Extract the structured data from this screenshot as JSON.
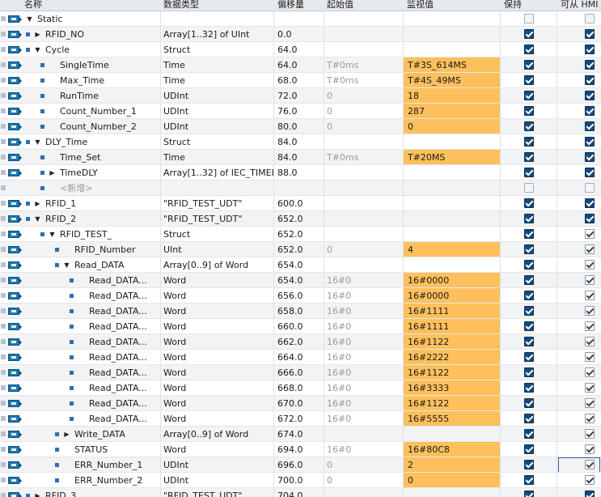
{
  "header": {
    "name": "名称",
    "datatype": "数据类型",
    "offset": "偏移量",
    "start_value": "起始值",
    "monitor_value": "监视值",
    "retain": "保持",
    "hmi": "可从 HMI"
  },
  "colors": {
    "highlight": "#fdc05c",
    "checkbox": "#17497c",
    "icon": "#1e78b4"
  },
  "rows": [
    {
      "level": 0,
      "expand": "down",
      "bullet": false,
      "icon": "interface-db-icon",
      "name": "Static",
      "type": "",
      "offset": "",
      "start": "",
      "monitor": "",
      "hl": false,
      "keep": "off",
      "hmi": "off"
    },
    {
      "level": 1,
      "expand": "right",
      "bullet": true,
      "icon": "interface-db-icon",
      "name": "RFID_NO",
      "type": "Array[1..32] of UInt",
      "offset": "0.0",
      "start": "",
      "monitor": "",
      "hl": false,
      "keep": "on",
      "hmi": "on"
    },
    {
      "level": 1,
      "expand": "down",
      "bullet": true,
      "icon": "interface-db-icon",
      "name": "Cycle",
      "type": "Struct",
      "offset": "64.0",
      "start": "",
      "monitor": "",
      "hl": false,
      "keep": "on",
      "hmi": "on"
    },
    {
      "level": 2,
      "expand": "",
      "bullet": true,
      "icon": "interface-db-icon",
      "name": "SingleTime",
      "type": "Time",
      "offset": "64.0",
      "start": "T#0ms",
      "monitor": "T#3S_614MS",
      "hl": true,
      "keep": "on",
      "hmi": "on"
    },
    {
      "level": 2,
      "expand": "",
      "bullet": true,
      "icon": "interface-db-icon",
      "name": "Max_Time",
      "type": "Time",
      "offset": "68.0",
      "start": "T#0ms",
      "monitor": "T#4S_49MS",
      "hl": true,
      "keep": "on",
      "hmi": "on"
    },
    {
      "level": 2,
      "expand": "",
      "bullet": true,
      "icon": "interface-db-icon",
      "name": "RunTime",
      "type": "UDInt",
      "offset": "72.0",
      "start": "0",
      "monitor": "18",
      "hl": true,
      "keep": "on",
      "hmi": "on"
    },
    {
      "level": 2,
      "expand": "",
      "bullet": true,
      "icon": "interface-db-icon",
      "name": "Count_Number_1",
      "type": "UDInt",
      "offset": "76.0",
      "start": "0",
      "monitor": "287",
      "hl": true,
      "keep": "on",
      "hmi": "on"
    },
    {
      "level": 2,
      "expand": "",
      "bullet": true,
      "icon": "interface-db-icon",
      "name": "Count_Number_2",
      "type": "UDInt",
      "offset": "80.0",
      "start": "0",
      "monitor": "0",
      "hl": true,
      "keep": "on",
      "hmi": "on"
    },
    {
      "level": 1,
      "expand": "down",
      "bullet": true,
      "icon": "interface-db-icon",
      "name": "DLY_Time",
      "type": "Struct",
      "offset": "84.0",
      "start": "",
      "monitor": "",
      "hl": false,
      "keep": "on",
      "hmi": "on"
    },
    {
      "level": 2,
      "expand": "",
      "bullet": true,
      "icon": "interface-db-icon",
      "name": "Time_Set",
      "type": "Time",
      "offset": "84.0",
      "start": "T#0ms",
      "monitor": "T#20MS",
      "hl": true,
      "keep": "on",
      "hmi": "on"
    },
    {
      "level": 2,
      "expand": "right",
      "bullet": true,
      "icon": "interface-db-icon",
      "name": "TimeDLY",
      "type": "Array[1..32] of IEC_TIMER",
      "offset": "88.0",
      "start": "",
      "monitor": "",
      "hl": false,
      "keep": "on",
      "hmi": "on"
    },
    {
      "level": 2,
      "expand": "",
      "bullet": true,
      "icon": "",
      "name": "<新增>",
      "type": "",
      "offset": "",
      "start": "",
      "monitor": "",
      "hl": false,
      "keep": "off",
      "hmi": "off",
      "isnew": true
    },
    {
      "level": 1,
      "expand": "right",
      "bullet": true,
      "icon": "interface-db-icon",
      "name": "RFID_1",
      "type": "\"RFID_TEST_UDT\"",
      "offset": "600.0",
      "start": "",
      "monitor": "",
      "hl": false,
      "keep": "on",
      "hmi": "on"
    },
    {
      "level": 1,
      "expand": "down",
      "bullet": true,
      "icon": "interface-db-icon",
      "name": "RFID_2",
      "type": "\"RFID_TEST_UDT\"",
      "offset": "652.0",
      "start": "",
      "monitor": "",
      "hl": false,
      "keep": "on",
      "hmi": "on"
    },
    {
      "level": 2,
      "expand": "down",
      "bullet": true,
      "icon": "interface-db-icon",
      "name": "RFID_TEST_",
      "type": "Struct",
      "offset": "652.0",
      "start": "",
      "monitor": "",
      "hl": false,
      "keep": "on",
      "hmi": "grey-on"
    },
    {
      "level": 3,
      "expand": "",
      "bullet": true,
      "icon": "interface-db-icon",
      "name": "RFID_Number",
      "type": "UInt",
      "offset": "652.0",
      "start": "0",
      "monitor": "4",
      "hl": true,
      "keep": "on",
      "hmi": "grey-on"
    },
    {
      "level": 3,
      "expand": "down",
      "bullet": true,
      "icon": "interface-db-icon",
      "name": "Read_DATA",
      "type": "Array[0..9] of Word",
      "offset": "654.0",
      "start": "",
      "monitor": "",
      "hl": false,
      "keep": "on",
      "hmi": "grey-on"
    },
    {
      "level": 4,
      "expand": "",
      "bullet": true,
      "icon": "interface-db-icon",
      "name": "Read_DATA...",
      "type": "Word",
      "offset": "654.0",
      "start": "16#0",
      "monitor": "16#0000",
      "hl": true,
      "keep": "on",
      "hmi": "grey-on"
    },
    {
      "level": 4,
      "expand": "",
      "bullet": true,
      "icon": "interface-db-icon",
      "name": "Read_DATA...",
      "type": "Word",
      "offset": "656.0",
      "start": "16#0",
      "monitor": "16#0000",
      "hl": true,
      "keep": "on",
      "hmi": "grey-on"
    },
    {
      "level": 4,
      "expand": "",
      "bullet": true,
      "icon": "interface-db-icon",
      "name": "Read_DATA...",
      "type": "Word",
      "offset": "658.0",
      "start": "16#0",
      "monitor": "16#1111",
      "hl": true,
      "keep": "on",
      "hmi": "grey-on"
    },
    {
      "level": 4,
      "expand": "",
      "bullet": true,
      "icon": "interface-db-icon",
      "name": "Read_DATA...",
      "type": "Word",
      "offset": "660.0",
      "start": "16#0",
      "monitor": "16#1111",
      "hl": true,
      "keep": "on",
      "hmi": "grey-on"
    },
    {
      "level": 4,
      "expand": "",
      "bullet": true,
      "icon": "interface-db-icon",
      "name": "Read_DATA...",
      "type": "Word",
      "offset": "662.0",
      "start": "16#0",
      "monitor": "16#1122",
      "hl": true,
      "keep": "on",
      "hmi": "grey-on"
    },
    {
      "level": 4,
      "expand": "",
      "bullet": true,
      "icon": "interface-db-icon",
      "name": "Read_DATA...",
      "type": "Word",
      "offset": "664.0",
      "start": "16#0",
      "monitor": "16#2222",
      "hl": true,
      "keep": "on",
      "hmi": "grey-on"
    },
    {
      "level": 4,
      "expand": "",
      "bullet": true,
      "icon": "interface-db-icon",
      "name": "Read_DATA...",
      "type": "Word",
      "offset": "666.0",
      "start": "16#0",
      "monitor": "16#1122",
      "hl": true,
      "keep": "on",
      "hmi": "grey-on"
    },
    {
      "level": 4,
      "expand": "",
      "bullet": true,
      "icon": "interface-db-icon",
      "name": "Read_DATA...",
      "type": "Word",
      "offset": "668.0",
      "start": "16#0",
      "monitor": "16#3333",
      "hl": true,
      "keep": "on",
      "hmi": "grey-on"
    },
    {
      "level": 4,
      "expand": "",
      "bullet": true,
      "icon": "interface-db-icon",
      "name": "Read_DATA...",
      "type": "Word",
      "offset": "670.0",
      "start": "16#0",
      "monitor": "16#1122",
      "hl": true,
      "keep": "on",
      "hmi": "grey-on"
    },
    {
      "level": 4,
      "expand": "",
      "bullet": true,
      "icon": "interface-db-icon",
      "name": "Read_DATA...",
      "type": "Word",
      "offset": "672.0",
      "start": "16#0",
      "monitor": "16#5555",
      "hl": true,
      "keep": "on",
      "hmi": "grey-on"
    },
    {
      "level": 3,
      "expand": "right",
      "bullet": true,
      "icon": "interface-db-icon",
      "name": "Write_DATA",
      "type": "Array[0..9] of Word",
      "offset": "674.0",
      "start": "",
      "monitor": "",
      "hl": false,
      "keep": "on",
      "hmi": "grey-on"
    },
    {
      "level": 3,
      "expand": "",
      "bullet": true,
      "icon": "interface-db-icon",
      "name": "STATUS",
      "type": "Word",
      "offset": "694.0",
      "start": "16#0",
      "monitor": "16#80C8",
      "hl": true,
      "keep": "on",
      "hmi": "grey-on"
    },
    {
      "level": 3,
      "expand": "",
      "bullet": true,
      "icon": "interface-db-icon",
      "name": "ERR_Number_1",
      "type": "UDInt",
      "offset": "696.0",
      "start": "0",
      "monitor": "2",
      "hl": true,
      "keep": "on",
      "hmi": "grey-on",
      "hmifocus": true
    },
    {
      "level": 3,
      "expand": "",
      "bullet": true,
      "icon": "interface-db-icon",
      "name": "ERR_Number_2",
      "type": "UDInt",
      "offset": "700.0",
      "start": "0",
      "monitor": "0",
      "hl": true,
      "keep": "on",
      "hmi": "grey-on"
    },
    {
      "level": 1,
      "expand": "right",
      "bullet": true,
      "icon": "interface-db-icon",
      "name": "RFID_3",
      "type": "\"RFID_TEST_UDT\"",
      "offset": "704.0",
      "start": "",
      "monitor": "",
      "hl": false,
      "keep": "on",
      "hmi": "on"
    }
  ]
}
